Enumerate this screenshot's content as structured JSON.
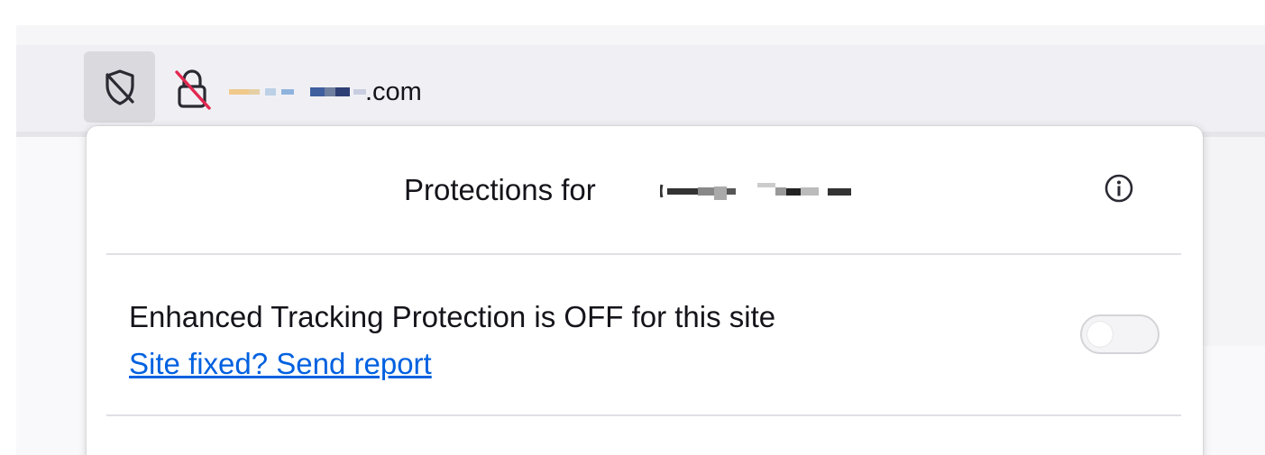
{
  "urlbar": {
    "domain_suffix": ".com",
    "shield_icon": "shield-slash-icon",
    "lock_icon": "lock-slash-icon"
  },
  "panel": {
    "title": "Protections for",
    "info_icon": "info-icon",
    "etp_status": "Enhanced Tracking Protection is OFF for this site",
    "report_link": "Site fixed? Send report",
    "toggle_on": false
  },
  "colors": {
    "link": "#0061e0",
    "urlbar_bg": "#f0f0f4",
    "shield_button_bg": "#dadade",
    "lock_slash": "#e22850"
  }
}
